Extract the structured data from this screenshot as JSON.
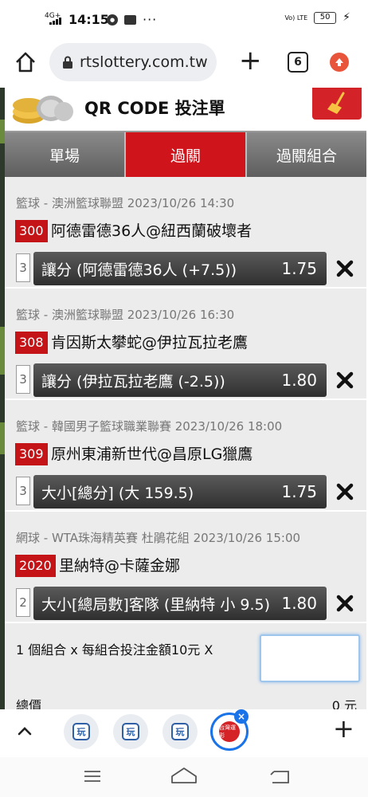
{
  "status_bar": {
    "network": "4G+",
    "time": "14:15",
    "more": "···",
    "volte": "Vo) LTE",
    "battery": "50",
    "colors": {
      "text": "#111111"
    }
  },
  "browser": {
    "url": "rtslottery.com.tw",
    "tab_count": "6",
    "icons": [
      "home-icon",
      "lock-icon",
      "plus-icon",
      "tabs-icon",
      "update-icon"
    ]
  },
  "page": {
    "title": "QR CODE 投注單",
    "tabs": [
      {
        "label": "單場",
        "active": false
      },
      {
        "label": "過關",
        "active": true
      },
      {
        "label": "過關組合",
        "active": false
      }
    ],
    "bets": [
      {
        "meta": "籃球 - 澳洲籃球聯盟 2023/10/26 14:30",
        "code": "300",
        "match": "阿德雷德36人@紐西蘭破壞者",
        "num": "3",
        "pick": "讓分 (阿德雷德36人 (+7.5))",
        "odds": "1.75"
      },
      {
        "meta": "籃球 - 澳洲籃球聯盟 2023/10/26 16:30",
        "code": "308",
        "match": "肯因斯太攀蛇@伊拉瓦拉老鷹",
        "num": "3",
        "pick": "讓分 (伊拉瓦拉老鷹 (-2.5))",
        "odds": "1.80"
      },
      {
        "meta": "籃球 - 韓國男子籃球職業聯賽 2023/10/26 18:00",
        "code": "309",
        "match": "原州東浦新世代@昌原LG獵鷹",
        "num": "3",
        "pick": "大小[總分] (大 159.5)",
        "odds": "1.75"
      },
      {
        "meta": "網球 - WTA珠海精英賽 杜鵑花組 2023/10/26 15:00",
        "code": "2020",
        "match": "里納特@卡薩金娜",
        "num": "2",
        "pick": "大小[總局數]客隊 (里納特 小 9.5)",
        "odds": "1.80"
      }
    ],
    "summary": "1 個組合 x 每組合投注金額10元 X",
    "amount_value": "",
    "total_label": "總價",
    "total_value": "0 元",
    "colors": {
      "brand_red": "#d0141b",
      "tab_gray": "#6b6b6b",
      "card_bg": "#ececec"
    }
  },
  "toolbar": {
    "tab_icon_text": "玩",
    "active_tab_text": "台灣運彩",
    "close": "×",
    "plus": "+"
  }
}
